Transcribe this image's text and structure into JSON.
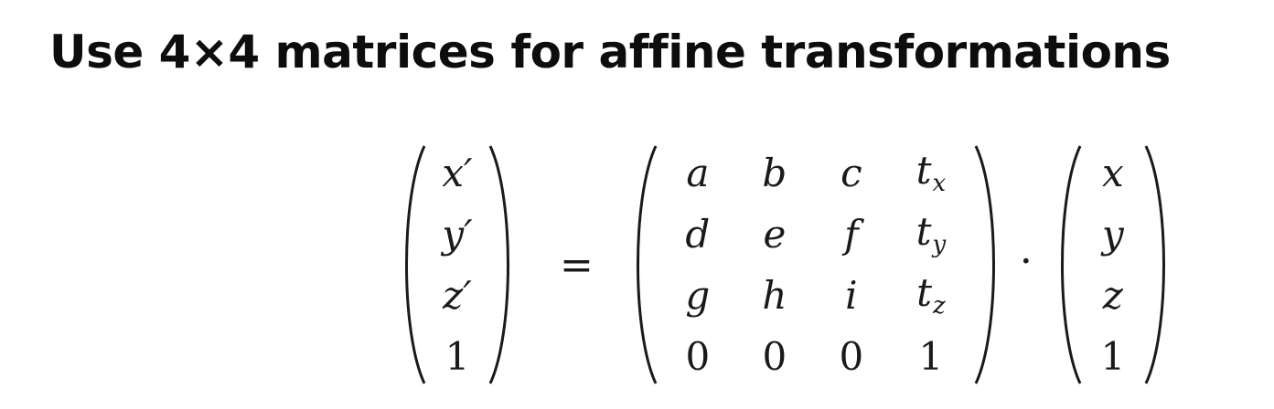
{
  "slide": {
    "title": "Use 4×4 matrices for affine transformations"
  },
  "equation": {
    "lhs_vector": [
      "x′",
      "y′",
      "z′",
      "1"
    ],
    "equals": "=",
    "matrix": {
      "rows": [
        [
          {
            "base": "a",
            "sub": ""
          },
          {
            "base": "b",
            "sub": ""
          },
          {
            "base": "c",
            "sub": ""
          },
          {
            "base": "t",
            "sub": "x"
          }
        ],
        [
          {
            "base": "d",
            "sub": ""
          },
          {
            "base": "e",
            "sub": ""
          },
          {
            "base": "f",
            "sub": ""
          },
          {
            "base": "t",
            "sub": "y"
          }
        ],
        [
          {
            "base": "g",
            "sub": ""
          },
          {
            "base": "h",
            "sub": ""
          },
          {
            "base": "i",
            "sub": ""
          },
          {
            "base": "t",
            "sub": "z"
          }
        ],
        [
          {
            "base": "0",
            "sub": ""
          },
          {
            "base": "0",
            "sub": ""
          },
          {
            "base": "0",
            "sub": ""
          },
          {
            "base": "1",
            "sub": ""
          }
        ]
      ]
    },
    "operator": "·",
    "rhs_vector": [
      "x",
      "y",
      "z",
      "1"
    ]
  }
}
